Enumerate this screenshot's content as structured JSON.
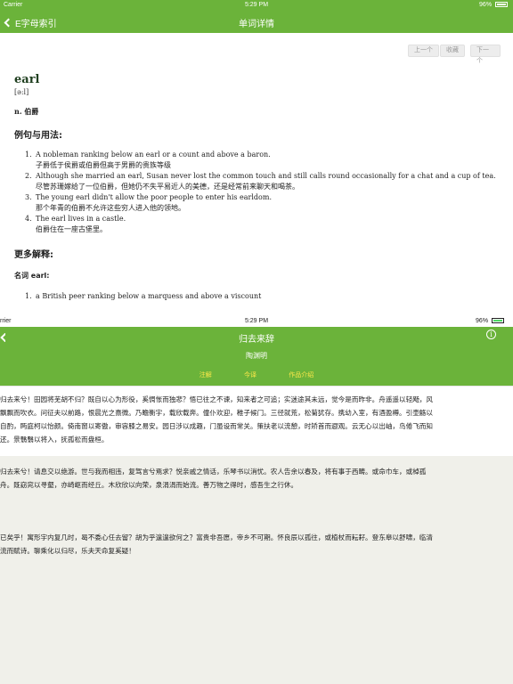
{
  "dict": {
    "status": {
      "carrier": "Carrier",
      "time": "5:29 PM",
      "battery": "96%"
    },
    "nav": {
      "back_label": "E字母索引",
      "title": "单词详情"
    },
    "toolbar": {
      "prev": "上一个",
      "fav": "收藏",
      "next": "下一个"
    },
    "word": "earl",
    "phonetic": "[ə:l]",
    "pos": "n. 伯爵",
    "examples_heading": "例句与用法:",
    "examples": [
      {
        "num": "1.",
        "en": "A nobleman ranking below an earl or a count and above a baron.",
        "zh": "子爵低于侯爵或伯爵但高于男爵的贵族等级"
      },
      {
        "num": "2.",
        "en": "Although she married an earl, Susan never lost the common touch and still calls round occasionally for a chat and a cup of tea.",
        "zh": "尽管苏珊嫁给了一位伯爵，但她仍不失平易近人的美德，还是经常前来聊天和喝茶。"
      },
      {
        "num": "3.",
        "en": "The young earl didn't allow the poor people to enter his earldom.",
        "zh": "那个年青的伯爵不允许这些穷人进入他的领地。"
      },
      {
        "num": "4.",
        "en": "The earl lives in a castle.",
        "zh": "伯爵住在一座古堡里。"
      }
    ],
    "more_heading": "更多解释:",
    "noun_heading": "名词 earl:",
    "definitions": [
      {
        "num": "1.",
        "text": "a British peer ranking below a marquess and above a viscount"
      }
    ]
  },
  "poem": {
    "status": {
      "carrier": "rrier",
      "time": "5:29 PM",
      "battery": "96%"
    },
    "title": "归去来辞",
    "author": "陶渊明",
    "tabs": [
      "注解",
      "今译",
      "作品介绍"
    ],
    "paragraphs": [
      [
        "归去来兮！田园将芜胡不归？既自以心为形役，奚惆怅而独悲？悟已往之不谏，知来者之可追；实迷途其未远，觉今是而昨非。舟遥遥以轻飏，风",
        "飘飘而吹衣。问征夫以前路，恨晨光之熹微。乃瞻衡宇，载欣载奔。僮仆欢迎，稚子候门。三径就荒，松菊犹存。携幼入室，有酒盈樽。引壶觞以",
        "自酌，眄庭柯以怡颜。倚南窗以寄傲，审容膝之易安。园日涉以成趣，门虽设而常关。策扶老以流憩，时矫首而遐观。云无心以出岫，鸟倦飞而知",
        "还。景翳翳以将入，抚孤松而盘桓。"
      ],
      [
        "归去来兮！请息交以绝游。世与我而相违，复驾言兮焉求？悦亲戚之情话，乐琴书以消忧。农人告余以春及，将有事于西畴。或命巾车，或棹孤",
        "舟。既窈窕以寻壑，亦崎岖而经丘。木欣欣以向荣，泉涓涓而始流。善万物之得时，感吾生之行休。"
      ],
      [
        "已矣乎！寓形宇内复几时，曷不委心任去留？胡为乎遑遑欲何之？富贵非吾愿，帝乡不可期。怀良辰以孤往，或植杖而耘耔。登东皋以舒啸，临清",
        "流而赋诗。聊乘化以归尽，乐夫天命复奚疑！"
      ]
    ]
  }
}
